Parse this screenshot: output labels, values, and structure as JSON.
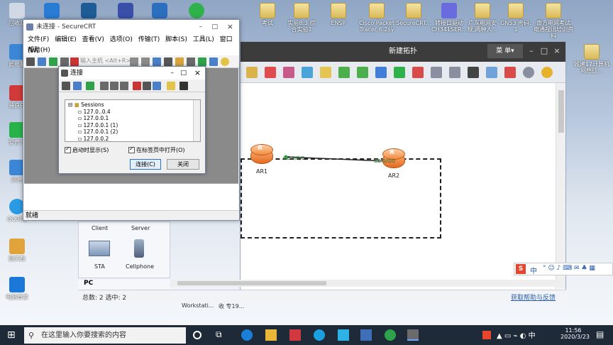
{
  "desktop": {
    "icons": [
      {
        "label": "回收站",
        "x": 0
      },
      {
        "label": "此电脑",
        "x": 1
      },
      {
        "label": "捕获PI",
        "x": 2
      },
      {
        "label": "爱奇艺",
        "x": 3
      },
      {
        "label": "网络",
        "x": 4
      },
      {
        "label": "QQ浏览",
        "x": 5
      },
      {
        "label": "回天数",
        "x": 6
      },
      {
        "label": "电脑管家",
        "x": 7
      }
    ],
    "top_files": [
      "考试",
      "实验8.3 综合实验1",
      "ENSP",
      "Cisco Packet Tracer 6.2sv",
      "SecureCRT...",
      "转接口驱动 CH341SER...",
      "广东电网安规,两种人...",
      "GNS3 密码: 1",
      "南方电网考试 电通视讯培训资料"
    ],
    "right_files": [
      "城建17计算机网络技..."
    ]
  },
  "ensp": {
    "title": "新建拓扑",
    "menu_label": "菜 单▾",
    "status_left": "总数: 2  选中: 2",
    "status_right": "获取帮助与反馈",
    "devices": [
      {
        "name": "AR1",
        "port": "GE 0/0/0"
      },
      {
        "name": "AR2",
        "port": "GE 0/0/0"
      }
    ],
    "panel": {
      "client": "Client",
      "server": "Server",
      "sta": "STA",
      "cellphone": "Cellphone",
      "pc": "PC"
    }
  },
  "crt": {
    "title": "未连接 - SecureCRT",
    "menu": [
      "文件(F)",
      "编辑(E)",
      "查看(V)",
      "选项(O)",
      "传输(T)",
      "脚本(S)",
      "工具(L)",
      "窗口(W)"
    ],
    "menu2": "帮助(H)",
    "host_placeholder": "输入主机 <Alt+R>",
    "status": "就绪"
  },
  "dialog": {
    "title": "连接",
    "root": "Sessions",
    "sessions": [
      "127.0..0.4",
      "127.0.0.1",
      "127.0.0.1 (1)",
      "127.0.0.1 (2)",
      "127.0.0.2"
    ],
    "show_on_start": "启动时显示(S)",
    "open_in_tab": "在标签页中打开(O)",
    "connect": "连接(C)",
    "close": "关闭"
  },
  "taskbar": {
    "search_placeholder": "在这里输入你要搜索的内容",
    "time": "11:56",
    "date": "2020/3/23",
    "ime": "中"
  },
  "overlay_text": [
    "Workstati...",
    "收  专19..."
  ]
}
